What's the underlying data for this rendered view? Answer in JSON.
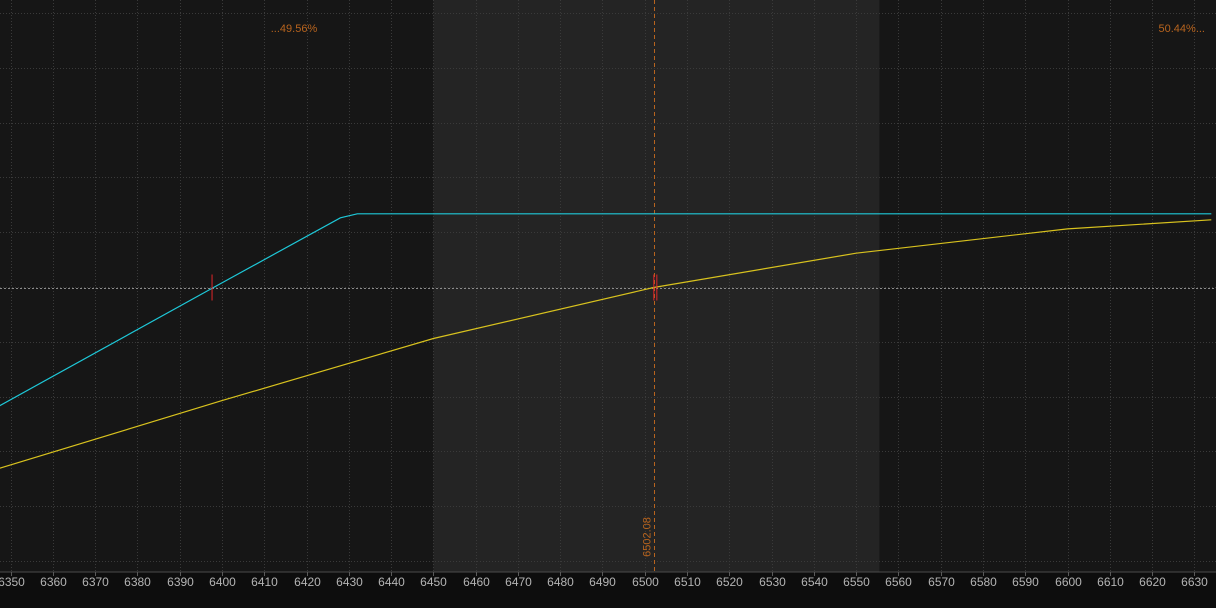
{
  "chart_data": {
    "type": "line",
    "xlim": [
      6347,
      6634
    ],
    "ylim": [
      0,
      100
    ],
    "x_ticks": [
      6350,
      6360,
      6370,
      6380,
      6390,
      6400,
      6410,
      6420,
      6430,
      6440,
      6450,
      6460,
      6470,
      6480,
      6490,
      6500,
      6510,
      6520,
      6530,
      6540,
      6550,
      6560,
      6570,
      6580,
      6590,
      6600,
      6610,
      6620,
      6630
    ],
    "x_tick_labels": [
      "6350",
      "6360",
      "6370",
      "6380",
      "6390",
      "6400",
      "6410",
      "6420",
      "6430",
      "6440",
      "6450",
      "6460",
      "6470",
      "6480",
      "6490",
      "6500",
      "6510",
      "6520",
      "6530",
      "6540",
      "6550",
      "6560",
      "6570",
      "6580",
      "6590",
      "6600",
      "6610",
      "6620",
      "6630"
    ],
    "grid": true,
    "shaded_range": [
      6450,
      6555.5
    ],
    "reference_line_y": 50,
    "vertical_marker": {
      "x": 6502.08,
      "label": "6502.08"
    },
    "probability_labels": {
      "left": "...49.56%",
      "right": "50.44%..."
    },
    "series": [
      {
        "color": "#1ec8d8",
        "x": [
          6347,
          6398,
          6428,
          6432,
          6634
        ],
        "y": [
          26.4,
          50,
          63.8,
          64.6,
          64.6
        ]
      },
      {
        "color": "#d8c21e",
        "x": [
          6347,
          6400,
          6450,
          6502.08,
          6550,
          6600,
          6634
        ],
        "y": [
          14.1,
          27.6,
          39.9,
          50,
          56.8,
          61.6,
          63.4
        ]
      }
    ],
    "crossing_markers": [
      {
        "x": 6398,
        "y": 50
      },
      {
        "x": 6502.5,
        "y": 50
      }
    ],
    "colors": {
      "background": "#161616",
      "shaded_band": "#242424",
      "grid": "#3a3a3a",
      "reference_line": "#8c8c8c",
      "marker": "#b8641e",
      "crossing": "#e0262a",
      "axis_text": "#b4b4b4",
      "probability_text": "#b8641e"
    }
  }
}
